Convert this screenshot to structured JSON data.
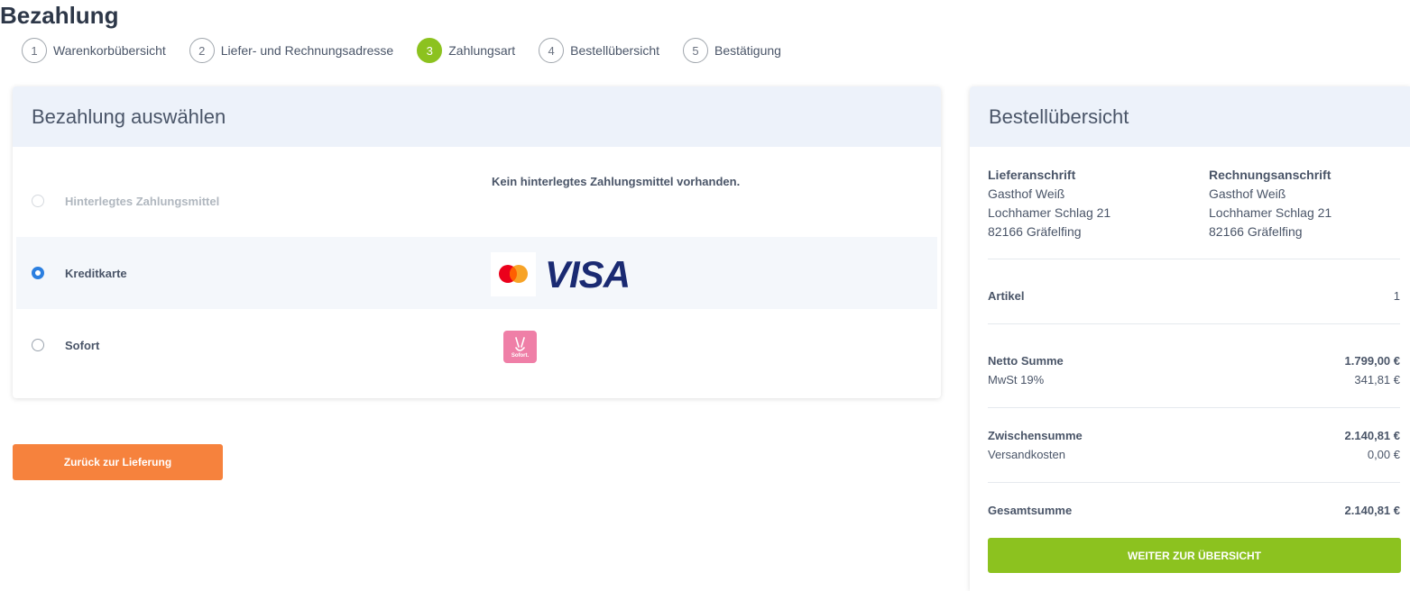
{
  "page": {
    "title": "Bezahlung"
  },
  "steps": [
    {
      "number": "1",
      "label": "Warenkorbübersicht",
      "active": false
    },
    {
      "number": "2",
      "label": "Liefer- und Rechnungsadresse",
      "active": false
    },
    {
      "number": "3",
      "label": "Zahlungsart",
      "active": true
    },
    {
      "number": "4",
      "label": "Bestellübersicht",
      "active": false
    },
    {
      "number": "5",
      "label": "Bestätigung",
      "active": false
    }
  ],
  "payment": {
    "heading": "Bezahlung auswählen",
    "no_method_text": "Kein hinterlegtes Zahlungsmittel vorhanden.",
    "options": [
      {
        "label": "Hinterlegtes Zahlungsmittel",
        "state": "disabled"
      },
      {
        "label": "Kreditkarte",
        "state": "checked"
      },
      {
        "label": "Sofort",
        "state": "unchecked"
      }
    ],
    "visa_logo_text": "VISA",
    "sofort_logo_text": "Sofort."
  },
  "back_button": {
    "label": "Zurück zur Lieferung"
  },
  "summary": {
    "heading": "Bestellübersicht",
    "delivery": {
      "title": "Lieferanschrift",
      "name": "Gasthof Weiß",
      "street": "Lochhamer Schlag 21",
      "city": "82166 Gräfelfing"
    },
    "billing": {
      "title": "Rechnungsanschrift",
      "name": "Gasthof Weiß",
      "street": "Lochhamer Schlag 21",
      "city": "82166 Gräfelfing"
    },
    "items_label": "Artikel",
    "items_count": "1",
    "net_label": "Netto Summe",
    "net_value": "1.799,00 €",
    "vat_label": "MwSt 19%",
    "vat_value": "341,81 €",
    "subtotal_label": "Zwischensumme",
    "subtotal_value": "2.140,81 €",
    "shipping_label": "Versandkosten",
    "shipping_value": "0,00 €",
    "total_label": "Gesamtsumme",
    "total_value": "2.140,81 €",
    "continue_label": "WEITER ZUR ÜBERSICHT"
  },
  "colors": {
    "accent_green": "#8cc21f",
    "accent_orange": "#f6823d",
    "radio_blue": "#2b7fe0",
    "visa_blue": "#1a2a72",
    "sofort_pink": "#ef7fa7"
  }
}
